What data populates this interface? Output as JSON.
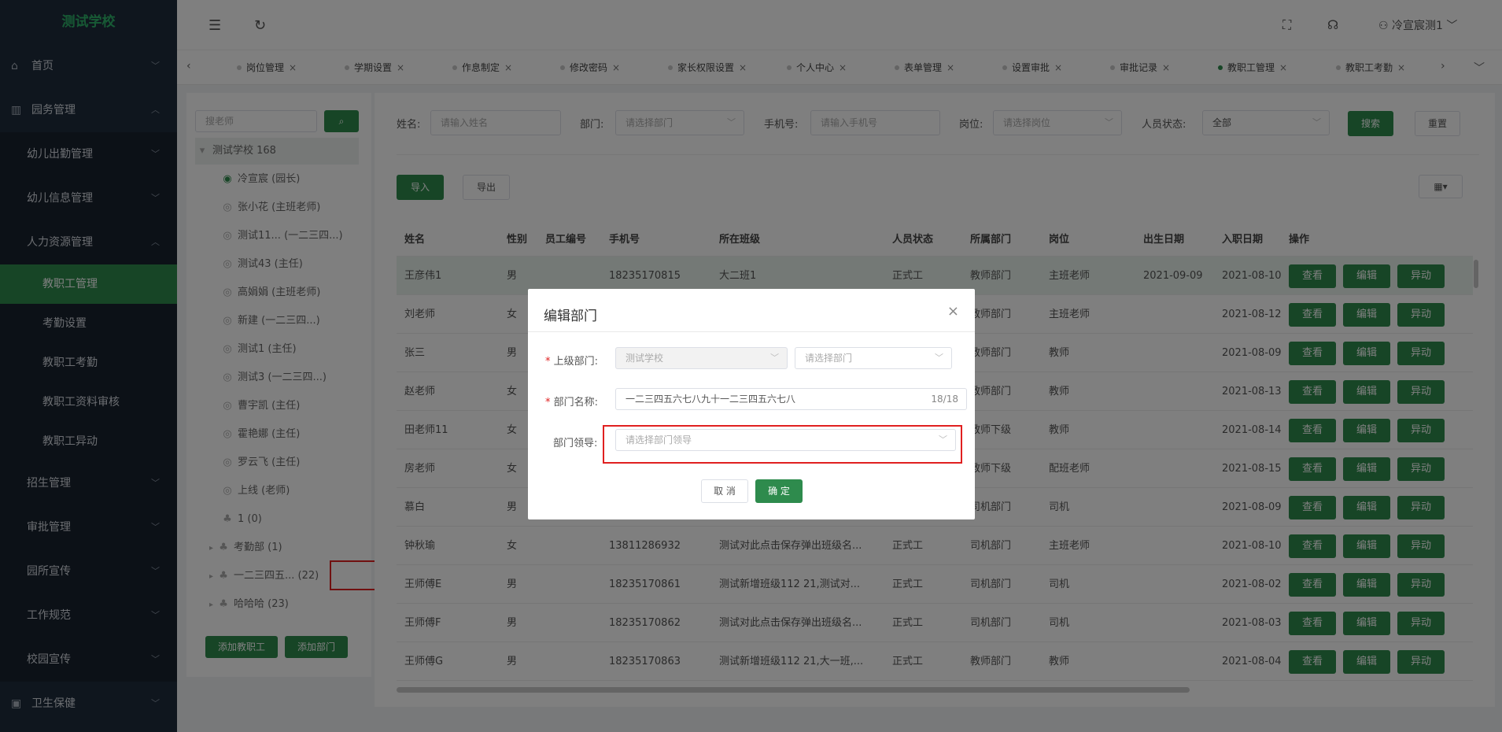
{
  "app": {
    "logo": "测试学校"
  },
  "sidebar": {
    "items": [
      {
        "label": "首页",
        "icon": "home-icon"
      },
      {
        "label": "园务管理",
        "icon": "building-icon"
      },
      {
        "label": "幼儿出勤管理"
      },
      {
        "label": "幼儿信息管理"
      },
      {
        "label": "人力资源管理"
      },
      {
        "label": "教职工管理"
      },
      {
        "label": "考勤设置"
      },
      {
        "label": "教职工考勤"
      },
      {
        "label": "教职工资料审核"
      },
      {
        "label": "教职工异动"
      },
      {
        "label": "招生管理"
      },
      {
        "label": "审批管理"
      },
      {
        "label": "园所宣传"
      },
      {
        "label": "工作规范"
      },
      {
        "label": "校园宣传"
      },
      {
        "label": "卫生保健",
        "icon": "health-icon"
      }
    ]
  },
  "topbar": {
    "user": "冷宣宸测1"
  },
  "tabs": [
    "岗位管理",
    "学期设置",
    "作息制定",
    "修改密码",
    "家长权限设置",
    "个人中心",
    "表单管理",
    "设置审批",
    "审批记录",
    "教职工管理",
    "教职工考勤"
  ],
  "tree": {
    "search_placeholder": "搜老师",
    "root": "测试学校 168",
    "nodes": [
      "冷宣宸 (园长)",
      "张小花 (主班老师)",
      "测试11... (一二三四...)",
      "测试43 (主任)",
      "高娟娟 (主班老师)",
      "新建 (一二三四...)",
      "测试1 (主任)",
      "测试3 (一二三四...)",
      "曹宇凯 (主任)",
      "霍艳娜 (主任)",
      "罗云飞 (主任)",
      "上线 (老师)",
      "1 (0)",
      "考勤部 (1)",
      "一二三四五... (22)",
      "哈哈哈 (23)"
    ],
    "add_staff": "添加教职工",
    "add_dept": "添加部门"
  },
  "filters": {
    "name_label": "姓名:",
    "name_placeholder": "请输入姓名",
    "dept_label": "部门:",
    "dept_placeholder": "请选择部门",
    "phone_label": "手机号:",
    "phone_placeholder": "请输入手机号",
    "post_label": "岗位:",
    "post_placeholder": "请选择岗位",
    "status_label": "人员状态:",
    "status_value": "全部",
    "search": "搜索",
    "reset": "重置"
  },
  "actions": {
    "import": "导入",
    "export": "导出",
    "grid": "▦▾"
  },
  "table": {
    "headers": [
      "姓名",
      "性别",
      "员工编号",
      "手机号",
      "所在班级",
      "人员状态",
      "所属部门",
      "岗位",
      "出生日期",
      "入职日期",
      "操作"
    ],
    "rows": [
      [
        "王彦伟1",
        "男",
        "",
        "18235170815",
        "大二班1",
        "正式工",
        "教师部门",
        "主班老师",
        "2021-09-09",
        "2021-08-10"
      ],
      [
        "刘老师",
        "女",
        "",
        "",
        "",
        "",
        "教师部门",
        "主班老师",
        "",
        "2021-08-12"
      ],
      [
        "张三",
        "男",
        "",
        "",
        "",
        "",
        "教师部门",
        "教师",
        "",
        "2021-08-09"
      ],
      [
        "赵老师",
        "女",
        "",
        "",
        "",
        "",
        "教师部门",
        "教师",
        "",
        "2021-08-13"
      ],
      [
        "田老师11",
        "女",
        "",
        "",
        "",
        "",
        "教师下级",
        "教师",
        "",
        "2021-08-14"
      ],
      [
        "房老师",
        "女",
        "",
        "",
        "",
        "",
        "教师下级",
        "配班老师",
        "",
        "2021-08-15"
      ],
      [
        "慕白",
        "男",
        "",
        "",
        "",
        "",
        "司机部门",
        "司机",
        "",
        "2021-08-09"
      ],
      [
        "钟秋瑜",
        "女",
        "",
        "13811286932",
        "测试对此点击保存弹出班级名...",
        "正式工",
        "司机部门",
        "主班老师",
        "",
        "2021-08-10"
      ],
      [
        "王师傅E",
        "男",
        "",
        "18235170861",
        "测试新增班级112 21,测试对...",
        "正式工",
        "司机部门",
        "司机",
        "",
        "2021-08-02"
      ],
      [
        "王师傅F",
        "男",
        "",
        "18235170862",
        "测试对此点击保存弹出班级名...",
        "正式工",
        "司机部门",
        "司机",
        "",
        "2021-08-03"
      ],
      [
        "王师傅G",
        "男",
        "",
        "18235170863",
        "测试新增班级112 21,大一班,...",
        "正式工",
        "教师部门",
        "教师",
        "",
        "2021-08-04"
      ]
    ],
    "ops": [
      "查看",
      "编辑",
      "异动"
    ]
  },
  "dialog": {
    "title": "编辑部门",
    "parent_label": "上级部门:",
    "parent_value": "测试学校",
    "parent_sub_placeholder": "请选择部门",
    "name_label": "部门名称:",
    "name_value": "一二三四五六七八九十一二三四五六七八",
    "name_count": "18/18",
    "leader_label": "部门领导:",
    "leader_placeholder": "请选择部门领导",
    "cancel": "取 消",
    "confirm": "确 定"
  },
  "colors": {
    "accent": "#2e8b4d",
    "sidebar": "#1f2d3d",
    "highlight": "#e02020"
  }
}
